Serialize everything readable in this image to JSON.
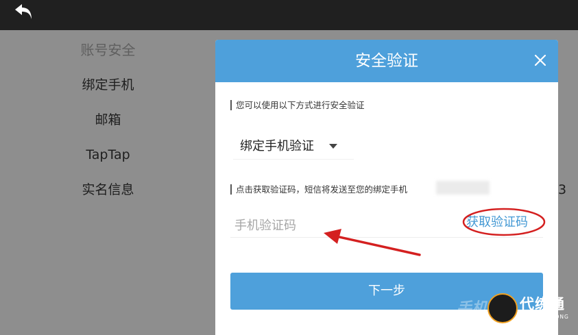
{
  "left_menu": {
    "title": "账号安全",
    "items": [
      "绑定手机",
      "邮箱",
      "TapTap",
      "实名信息"
    ]
  },
  "right_digit": "3",
  "dialog": {
    "title": "安全验证",
    "intro_label": "您可以使用以下方式进行安全验证",
    "method_selected": "绑定手机验证",
    "send_label": "点击获取验证码，短信将发送至您的绑定手机",
    "code_placeholder": "手机验证码",
    "get_code_label": "获取验证码",
    "next_label": "下一步"
  },
  "watermark": {
    "faint_text": "手机",
    "brand": "代练通",
    "sub": "DAI LIAN TONG"
  },
  "colors": {
    "accent": "#4ea0db",
    "link": "#4499d4",
    "annotation": "#d42020"
  },
  "icons": [
    "back-arrow-icon",
    "close-icon",
    "dropdown-caret-icon"
  ]
}
